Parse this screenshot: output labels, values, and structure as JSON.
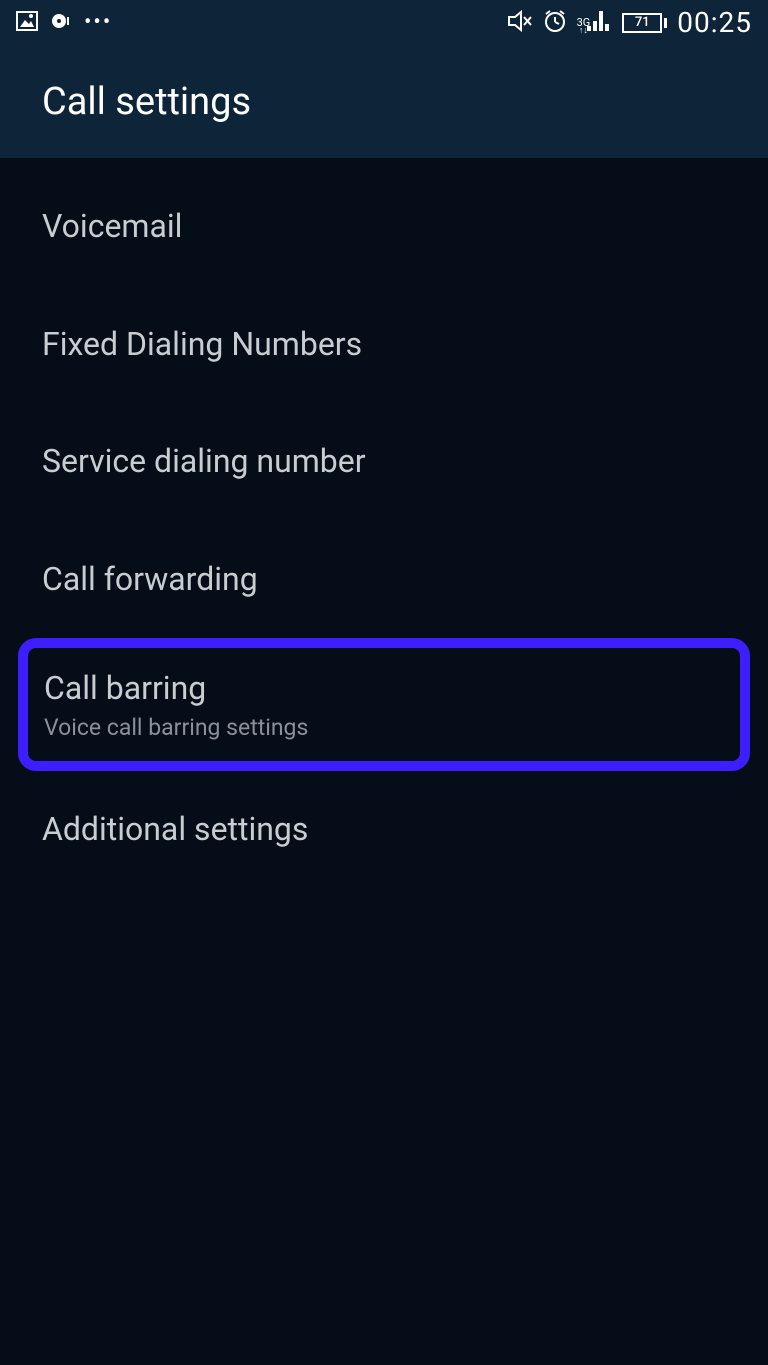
{
  "status_bar": {
    "network_type": "3G",
    "battery_level": "71",
    "time": "00:25"
  },
  "header": {
    "title": "Call settings"
  },
  "items": [
    {
      "title": "Voicemail"
    },
    {
      "title": "Fixed Dialing Numbers"
    },
    {
      "title": "Service dialing number"
    },
    {
      "title": "Call forwarding"
    },
    {
      "title": "Call barring",
      "subtitle": "Voice call barring settings",
      "highlighted": true
    },
    {
      "title": "Additional settings"
    }
  ]
}
